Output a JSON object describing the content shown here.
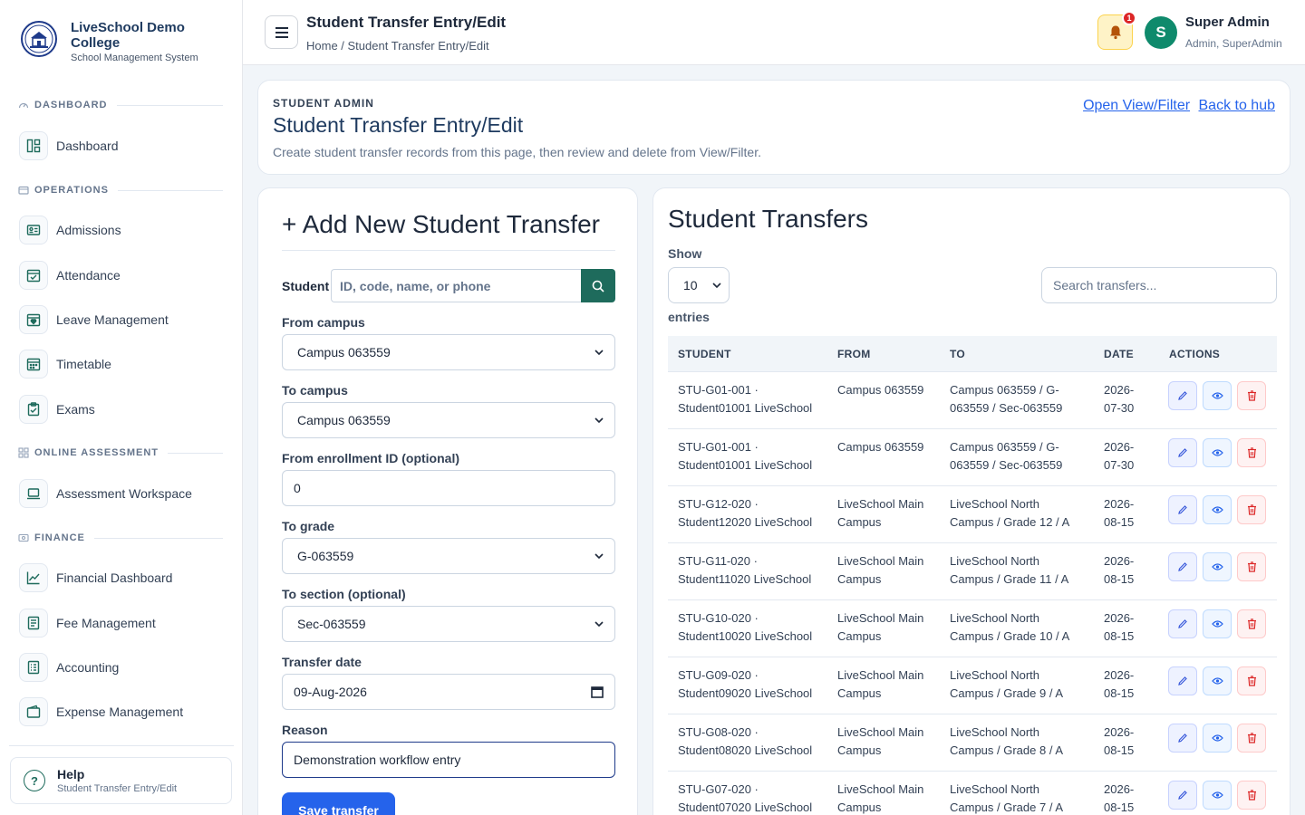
{
  "brand": {
    "name": "LiveSchool Demo College",
    "subtitle": "School Management System"
  },
  "sidebar": {
    "sections": [
      {
        "label": "DASHBOARD",
        "items": [
          {
            "label": "Dashboard",
            "icon": "layout-icon"
          }
        ]
      },
      {
        "label": "OPERATIONS",
        "items": [
          {
            "label": "Admissions",
            "icon": "id-card-icon"
          },
          {
            "label": "Attendance",
            "icon": "calendar-check-icon"
          },
          {
            "label": "Leave Management",
            "icon": "calendar-heart-icon"
          },
          {
            "label": "Timetable",
            "icon": "calendar-grid-icon"
          },
          {
            "label": "Exams",
            "icon": "clipboard-check-icon"
          }
        ]
      },
      {
        "label": "ONLINE ASSESSMENT",
        "items": [
          {
            "label": "Assessment Workspace",
            "icon": "laptop-icon"
          }
        ]
      },
      {
        "label": "FINANCE",
        "items": [
          {
            "label": "Financial Dashboard",
            "icon": "chart-line-icon"
          },
          {
            "label": "Fee Management",
            "icon": "receipt-icon"
          },
          {
            "label": "Accounting",
            "icon": "ledger-icon"
          },
          {
            "label": "Expense Management",
            "icon": "wallet-icon"
          }
        ]
      }
    ],
    "help": {
      "title": "Help",
      "subtitle": "Student Transfer Entry/Edit"
    }
  },
  "topbar": {
    "title": "Student Transfer Entry/Edit",
    "breadcrumb": "Home / Student Transfer Entry/Edit",
    "notification_count": "1",
    "user": {
      "initial": "S",
      "name": "Super Admin",
      "role": "Admin, SuperAdmin"
    }
  },
  "header": {
    "eyebrow": "STUDENT ADMIN",
    "title": "Student Transfer Entry/Edit",
    "description": "Create student transfer records from this page, then review and delete from View/Filter.",
    "link_view": "Open View/Filter",
    "link_back": "Back to hub"
  },
  "form": {
    "title": "+ Add New Student Transfer",
    "student_label": "Student",
    "student_placeholder": "ID, code, name, or phone",
    "from_campus_label": "From campus",
    "from_campus_value": "Campus 063559",
    "to_campus_label": "To campus",
    "to_campus_value": "Campus 063559",
    "enrollment_label": "From enrollment ID (optional)",
    "enrollment_value": "0",
    "grade_label": "To grade",
    "grade_value": "G-063559",
    "section_label": "To section (optional)",
    "section_value": "Sec-063559",
    "date_label": "Transfer date",
    "date_value": "09-Aug-2026",
    "reason_label": "Reason",
    "reason_value": "Demonstration workflow entry",
    "save_label": "Save transfer"
  },
  "table": {
    "title": "Student Transfers",
    "show_label": "Show",
    "page_size": "10",
    "entries_label": "entries",
    "search_placeholder": "Search transfers...",
    "columns": [
      "STUDENT",
      "FROM",
      "TO",
      "DATE",
      "ACTIONS"
    ],
    "rows": [
      {
        "student": [
          "STU-G01-001 ·",
          "Student01001 LiveSchool"
        ],
        "from": [
          "Campus 063559",
          ""
        ],
        "to": [
          "Campus 063559 / G-",
          "063559 / Sec-063559"
        ],
        "date": [
          "2026-",
          "07-30"
        ]
      },
      {
        "student": [
          "STU-G01-001 ·",
          "Student01001 LiveSchool"
        ],
        "from": [
          "Campus 063559",
          ""
        ],
        "to": [
          "Campus 063559 / G-",
          "063559 / Sec-063559"
        ],
        "date": [
          "2026-",
          "07-30"
        ]
      },
      {
        "student": [
          "STU-G12-020 ·",
          "Student12020 LiveSchool"
        ],
        "from": [
          "LiveSchool Main",
          "Campus"
        ],
        "to": [
          "LiveSchool North",
          "Campus / Grade 12 / A"
        ],
        "date": [
          "2026-",
          "08-15"
        ]
      },
      {
        "student": [
          "STU-G11-020 ·",
          "Student11020 LiveSchool"
        ],
        "from": [
          "LiveSchool Main",
          "Campus"
        ],
        "to": [
          "LiveSchool North",
          "Campus / Grade 11 / A"
        ],
        "date": [
          "2026-",
          "08-15"
        ]
      },
      {
        "student": [
          "STU-G10-020 ·",
          "Student10020 LiveSchool"
        ],
        "from": [
          "LiveSchool Main",
          "Campus"
        ],
        "to": [
          "LiveSchool North",
          "Campus / Grade 10 / A"
        ],
        "date": [
          "2026-",
          "08-15"
        ]
      },
      {
        "student": [
          "STU-G09-020 ·",
          "Student09020 LiveSchool"
        ],
        "from": [
          "LiveSchool Main",
          "Campus"
        ],
        "to": [
          "LiveSchool North",
          "Campus / Grade 9 / A"
        ],
        "date": [
          "2026-",
          "08-15"
        ]
      },
      {
        "student": [
          "STU-G08-020 ·",
          "Student08020 LiveSchool"
        ],
        "from": [
          "LiveSchool Main",
          "Campus"
        ],
        "to": [
          "LiveSchool North",
          "Campus / Grade 8 / A"
        ],
        "date": [
          "2026-",
          "08-15"
        ]
      },
      {
        "student": [
          "STU-G07-020 ·",
          "Student07020 LiveSchool"
        ],
        "from": [
          "LiveSchool Main",
          "Campus"
        ],
        "to": [
          "LiveSchool North",
          "Campus / Grade 7 / A"
        ],
        "date": [
          "2026-",
          "08-15"
        ]
      }
    ]
  },
  "colors": {
    "primary": "#1e6b5c",
    "accent": "#2563eb",
    "brand": "#1e3a5f",
    "danger": "#dc2626"
  }
}
